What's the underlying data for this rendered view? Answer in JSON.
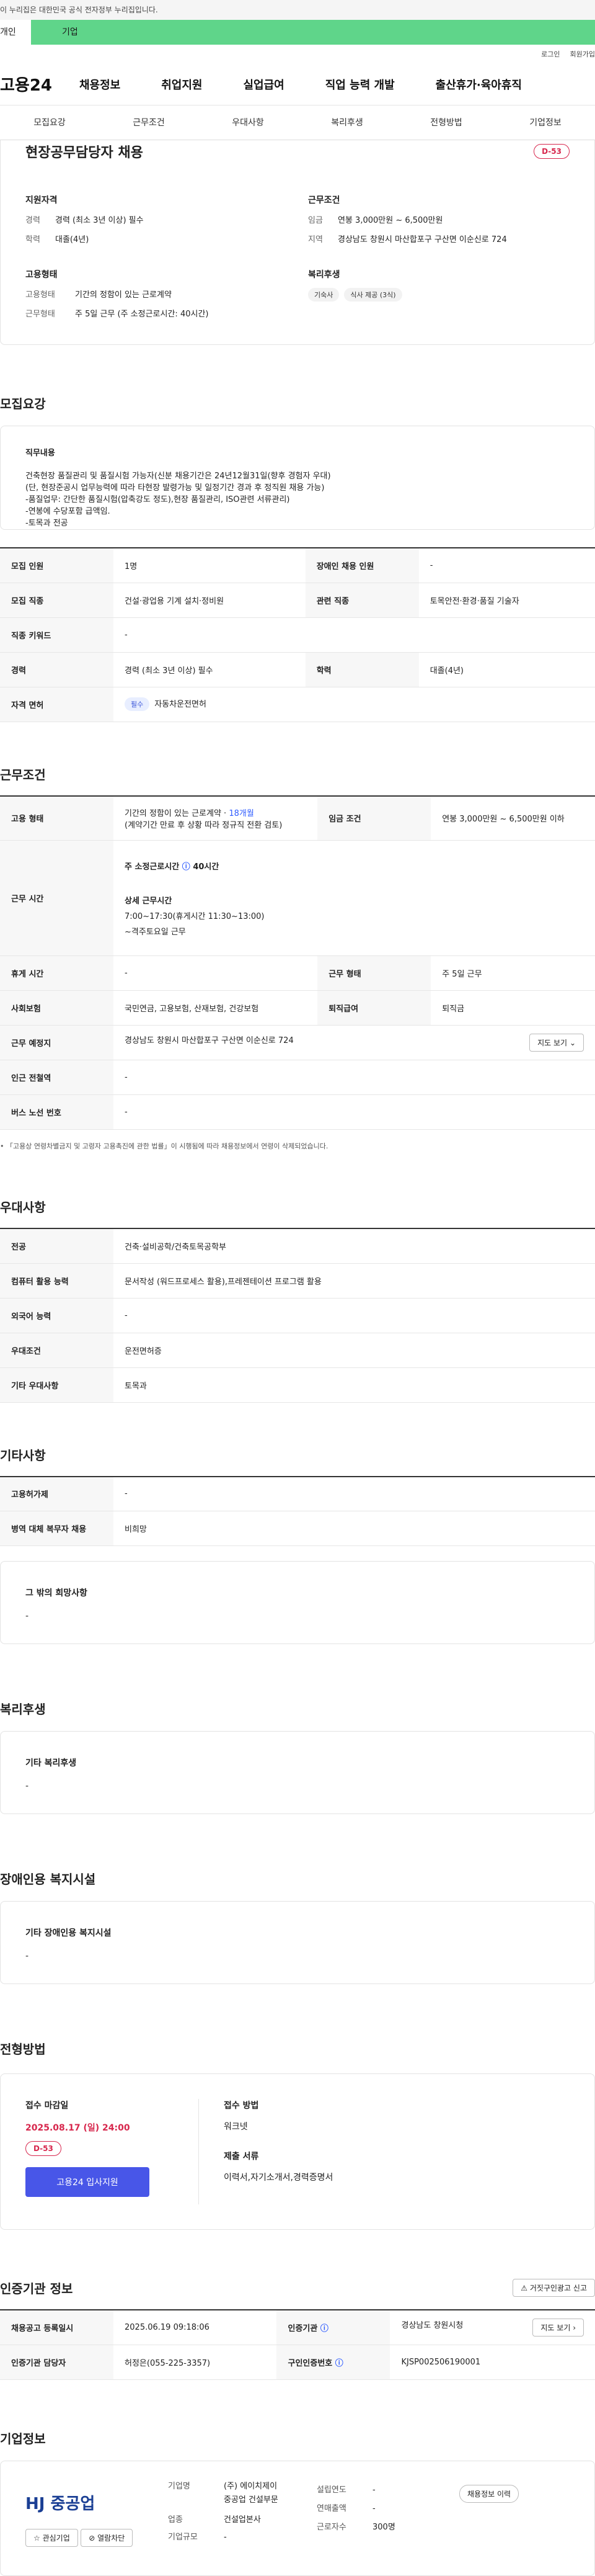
{
  "gov_banner": "이 누리집은 대한민국 공식 전자정부 누리집입니다.",
  "tabs": [
    "개인",
    "기업"
  ],
  "util": [
    "로그인",
    "회원가입"
  ],
  "logo": "고용24",
  "gnb": [
    "채용정보",
    "취업지원",
    "실업급여",
    "직업 능력 개발",
    "출산휴가·육아휴직"
  ],
  "subtabs": [
    "모집요강",
    "근무조건",
    "우대사항",
    "복리후생",
    "전형방법",
    "기업정보"
  ],
  "header": {
    "title": "현장공무담당자 채용",
    "dday": "D-53",
    "qual_h": "지원자격",
    "qual": [
      {
        "k": "경력",
        "v": "경력 (최소 3년 이상) 필수"
      },
      {
        "k": "학력",
        "v": "대졸(4년)"
      }
    ],
    "cond_h": "근무조건",
    "cond": [
      {
        "k": "임금",
        "v": "연봉 3,000만원 ~ 6,500만원"
      },
      {
        "k": "지역",
        "v": "경상남도 창원시 마산합포구 구산면 이순신로 724"
      }
    ],
    "emp_h": "고용형태",
    "emp": [
      {
        "k": "고용형태",
        "v": "기간의 정함이 있는 근로계약"
      },
      {
        "k": "근무형태",
        "v": "주 5일 근무 (주 소정근로시간: 40시간)"
      }
    ],
    "welfare_h": "복리후생",
    "welfare": [
      "기숙사",
      "식사 제공 (3식)"
    ]
  },
  "recruit": {
    "h": "모집요강",
    "duty_h": "직무내용",
    "duty": [
      "건축현장 품질관리 및 품질시험 가능자(신분 채용기간은 24년12월31일(향후 경험자 우대)",
      "(단, 현장준공시 업무능력에 따라 타현장 발령가능 및 일정기간 경과 후 정직원 채용 가능)",
      "-품질업무: 간단한 품질시험(압축강도 정도),현장 품질관리, ISO관련 서류관리)",
      "-연봉에 수당포함 급액임.",
      "-토목과 전공"
    ],
    "rows": [
      [
        "모집 인원",
        "1명",
        "장애인 채용 인원",
        "-"
      ],
      [
        "모집 직종",
        "건설·광업용 기계 설치·정비원",
        "관련 직종",
        "토목안전·환경·품질 기술자"
      ],
      [
        "직종 키워드",
        "-"
      ],
      [
        "경력",
        "경력 (최소 3년 이상) 필수",
        "학력",
        "대졸(4년)"
      ]
    ],
    "license_k": "자격 면허",
    "license_tag": "필수",
    "license_v": "자동차운전면허"
  },
  "work": {
    "h": "근무조건",
    "type_k": "고용 형태",
    "type_v": "기간의 정함이 있는 근로계약 · ",
    "type_months": "18개월",
    "type_note": "(계약기간 만료 후 상황 따라 정규직 전환 검토)",
    "wage_k": "임금 조건",
    "wage_v": "연봉 3,000만원 ~ 6,500만원 이하",
    "time_k": "근무 시간",
    "time_h1": "주 소정근로시간",
    "time_v1": "40시간",
    "time_h2": "상세 근무시간",
    "time_v2": "7:00~17:30(휴게시간 11:30~13:00)",
    "time_v3": "~격주토요일 근무",
    "rows": [
      [
        "휴게 시간",
        "-",
        "근무 형태",
        "주 5일 근무"
      ],
      [
        "사회보험",
        "국민연금, 고용보험, 산재보험, 건강보험",
        "퇴직급여",
        "퇴직금"
      ]
    ],
    "loc_k": "근무 예정지",
    "loc_v": "경상남도 창원시 마산합포구 구산면 이순신로 724",
    "map_btn": "지도 보기",
    "station_k": "인근 전철역",
    "station_v": "-",
    "bus_k": "버스 노선 번호",
    "bus_v": "-",
    "note": "「고용상 연령차별금지 및 고령자 고용촉진에 관한 법률」이 시행됨에 따라 채용정보에서 연령이 삭제되었습니다."
  },
  "prefer": {
    "h": "우대사항",
    "rows": [
      [
        "전공",
        "건축·설비공학/건축토목공학부"
      ],
      [
        "컴퓨터 활용 능력",
        "문서작성 (워드프로세스 활용),프레젠테이션 프로그램 활용"
      ],
      [
        "외국어 능력",
        "-"
      ],
      [
        "우대조건",
        "운전면허증"
      ],
      [
        "기타 우대사항",
        "토목과"
      ]
    ]
  },
  "other": {
    "h": "기타사항",
    "rows": [
      [
        "고용허가제",
        "-"
      ],
      [
        "병역 대체 복무자 채용",
        "비희망"
      ]
    ],
    "wish_h": "그 밖의 희망사항",
    "wish_v": "-"
  },
  "welfare": {
    "h": "복리후생",
    "box_h": "기타 복리후생",
    "box_v": "-"
  },
  "disabled": {
    "h": "장애인용 복지시설",
    "box_h": "기타 장애인용 복지시설",
    "box_v": "-"
  },
  "process": {
    "h": "전형방법",
    "deadline_h": "접수 마감일",
    "deadline": "2025.08.17 (일) 24:00",
    "dday": "D-53",
    "apply_btn": "고용24 입사지원",
    "method_h": "접수 방법",
    "method": "워크넷",
    "docs_h": "제출 서류",
    "docs": "이력서,자기소개서,경력증명서"
  },
  "cert": {
    "h": "인증기관 정보",
    "report_btn": "거짓구인광고 신고",
    "rows": [
      [
        "채용공고 등록일시",
        "2025.06.19 09:18:06",
        "인증기관",
        "경상남도 창원시청"
      ],
      [
        "인증기관 담당자",
        "허정은(055-225-3357)",
        "구인인증번호",
        "KJSP002506190001"
      ]
    ],
    "map_btn": "지도 보기"
  },
  "company": {
    "h": "기업정보",
    "logo": "HJ 중공업",
    "fav": "관심기업",
    "block": "열람차단",
    "k1": "기업명",
    "v1a": "(주) 에이치제이",
    "v1b": "중공업 건설부문",
    "k2": "업종",
    "v2": "건설업본사",
    "k3": "기업규모",
    "v3": "-",
    "k4": "설립연도",
    "v4": "-",
    "k5": "연매출액",
    "v5": "-",
    "k6": "근로자수",
    "v6": "300명",
    "info_btn": "채용정보 이력"
  }
}
